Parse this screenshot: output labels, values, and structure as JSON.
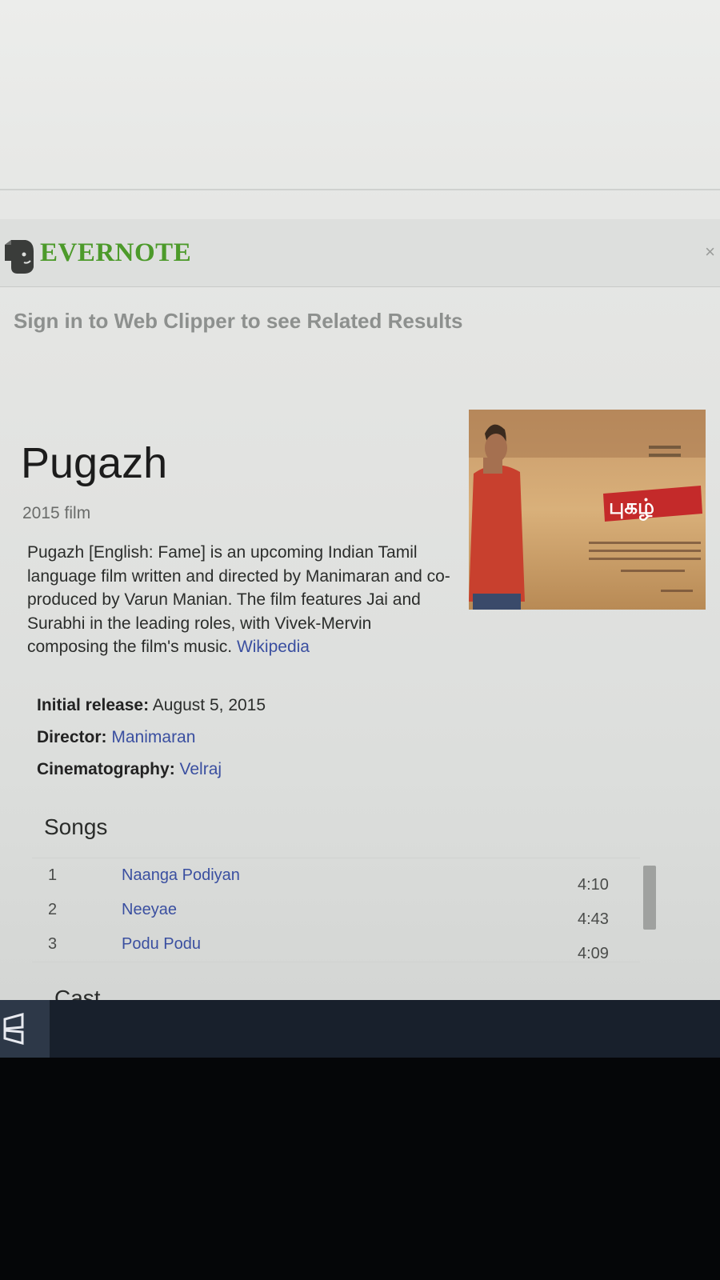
{
  "evernote": {
    "brand": "EVERNOTE",
    "close_label": "×",
    "sign_in_message": "Sign in to Web Clipper to see Related Results"
  },
  "knowledge_panel": {
    "title": "Pugazh",
    "subtitle": "2015 film",
    "description": "Pugazh [English: Fame] is an upcoming Indian Tamil language film written and directed by Manimaran and co-produced by Varun Manian. The film features Jai and Surabhi in the leading roles, with Vivek-Mervin composing the film's music.",
    "source_link": "Wikipedia",
    "poster_title_text": "புகழ்",
    "facts": [
      {
        "label": "Initial release:",
        "value": "August 5, 2015"
      },
      {
        "label": "Director:",
        "value": "Manimaran"
      },
      {
        "label": "Cinematography:",
        "value": "Velraj"
      }
    ],
    "songs_heading": "Songs",
    "songs": [
      {
        "num": "1",
        "name": "Naanga Podiyan",
        "duration": "4:10"
      },
      {
        "num": "2",
        "name": "Neeyae",
        "duration": "4:43"
      },
      {
        "num": "3",
        "name": "Podu Podu",
        "duration": "4:09"
      }
    ],
    "next_section_partial": "Cast"
  },
  "colors": {
    "evernote_green": "#4c9a2a",
    "link_blue": "#3a4fa0",
    "taskbar": "#18202c"
  },
  "icons": [
    "evernote-elephant-icon",
    "close-icon",
    "windows-start-icon"
  ]
}
